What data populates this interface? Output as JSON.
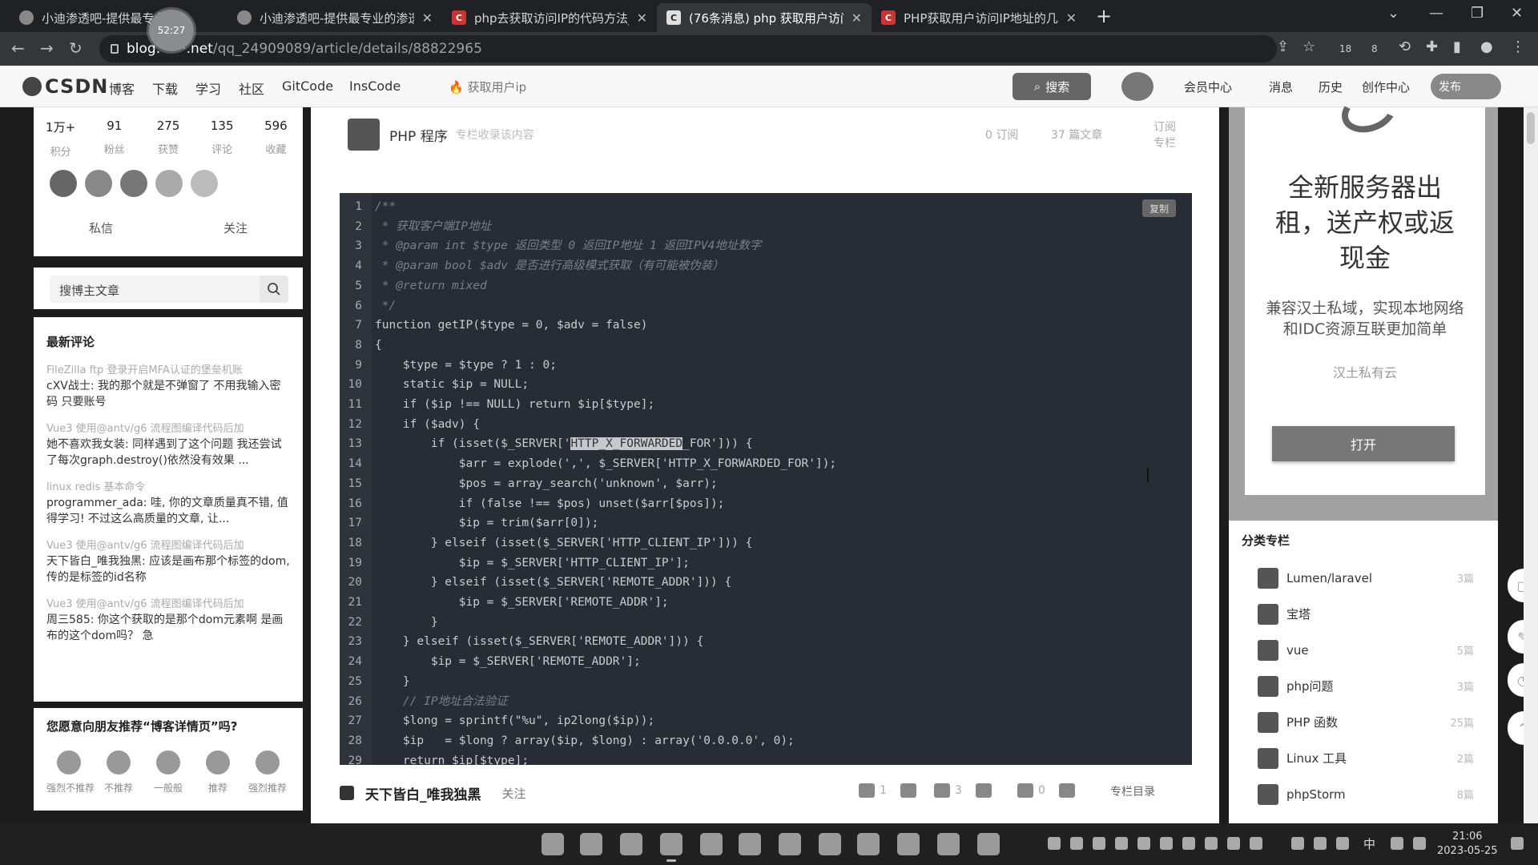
{
  "browser": {
    "timer": "52:27",
    "tabs": [
      {
        "title": "小迪渗透吧-提供最专业",
        "active": false
      },
      {
        "title": "小迪渗透吧-提供最专业的渗透测",
        "active": false
      },
      {
        "title": "php去获取访问IP的代码方法_百",
        "active": false
      },
      {
        "title": "(76条消息) php 获取用户访问",
        "active": true
      },
      {
        "title": "PHP获取用户访问IP地址的几种",
        "active": false
      }
    ],
    "url_host": "blog",
    "url_mid": "net",
    "url_path": "/qq_24909089/article/details/88822965",
    "ext_badges": [
      "18",
      "8"
    ]
  },
  "csdn_nav": {
    "logo": "CSDN",
    "links": [
      "博客",
      "下载",
      "学习",
      "社区",
      "GitCode",
      "InsCode"
    ],
    "search_hint": "获取用户ip",
    "search_button": "搜索",
    "right_links": [
      "会员中心",
      "消息",
      "历史",
      "创作中心"
    ],
    "publish": "发布"
  },
  "profile": {
    "stats": [
      {
        "value": "1万+",
        "label": "积分"
      },
      {
        "value": "91",
        "label": "粉丝"
      },
      {
        "value": "275",
        "label": "获赞"
      },
      {
        "value": "135",
        "label": "评论"
      },
      {
        "value": "596",
        "label": "收藏"
      }
    ],
    "actions": [
      "私信",
      "关注"
    ]
  },
  "blog_search": {
    "placeholder": "搜博主文章"
  },
  "latest_comments": {
    "title": "最新评论",
    "items": [
      {
        "source": "FileZilla ftp 登录开启MFA认证的堡垒机账",
        "text": "cXV战士: 我的那个就是不弹窗了 不用我输入密码 只要账号"
      },
      {
        "source": "Vue3 使用@antv/g6 流程图编译代码后加",
        "text": "她不喜欢我女装: 同样遇到了这个问题 我还尝试了每次graph.destroy()依然没有效果 ..."
      },
      {
        "source": "linux redis 基本命令",
        "text": "programmer_ada: 哇, 你的文章质量真不错, 值得学习! 不过这么高质量的文章, 让..."
      },
      {
        "source": "Vue3 使用@antv/g6 流程图编译代码后加",
        "text": "天下皆白_唯我独黑: 应该是画布那个标签的dom, 传的是标签的id名称"
      },
      {
        "source": "Vue3 使用@antv/g6 流程图编译代码后加",
        "text": "周三585: 你这个获取的是那个dom元素啊 是画布的这个dom吗？ 急"
      }
    ]
  },
  "recommend": {
    "title": "您愿意向朋友推荐“博客详情页”吗?",
    "options": [
      "强烈不推荐",
      "不推荐",
      "一般般",
      "推荐",
      "强烈推荐"
    ]
  },
  "column": {
    "name": "PHP 程序",
    "desc": "专栏收录该内容",
    "subscribers": "0 订阅",
    "articles": "37 篇文章",
    "subscribe": "订阅专栏"
  },
  "code": {
    "copy_label": "复制",
    "lines": [
      {
        "n": "1",
        "text": "/**",
        "comment": true
      },
      {
        "n": "2",
        "text": " * 获取客户端IP地址",
        "comment": true
      },
      {
        "n": "3",
        "text": " * @param int $type 返回类型 0 返回IP地址 1 返回IPV4地址数字",
        "comment": true
      },
      {
        "n": "4",
        "text": " * @param bool $adv 是否进行高级模式获取（有可能被伪装）",
        "comment": true
      },
      {
        "n": "5",
        "text": " * @return mixed",
        "comment": true
      },
      {
        "n": "6",
        "text": " */",
        "comment": true
      },
      {
        "n": "7",
        "text": "function getIP($type = 0, $adv = false)",
        "comment": false
      },
      {
        "n": "8",
        "text": "{",
        "comment": false
      },
      {
        "n": "9",
        "text": "    $type = $type ? 1 : 0;",
        "comment": false
      },
      {
        "n": "10",
        "text": "    static $ip = NULL;",
        "comment": false
      },
      {
        "n": "11",
        "text": "    if ($ip !== NULL) return $ip[$type];",
        "comment": false
      },
      {
        "n": "12",
        "text": "    if ($adv) {",
        "comment": false
      },
      {
        "n": "13",
        "pre": "        if (isset($_SERVER['",
        "hl": "HTTP_X_FORWARDED",
        "post": "_FOR'])) {",
        "comment": false
      },
      {
        "n": "14",
        "text": "            $arr = explode(',', $_SERVER['HTTP_X_FORWARDED_FOR']);",
        "comment": false
      },
      {
        "n": "15",
        "text": "            $pos = array_search('unknown', $arr);",
        "comment": false
      },
      {
        "n": "16",
        "text": "            if (false !== $pos) unset($arr[$pos]);",
        "comment": false
      },
      {
        "n": "17",
        "text": "            $ip = trim($arr[0]);",
        "comment": false
      },
      {
        "n": "18",
        "text": "        } elseif (isset($_SERVER['HTTP_CLIENT_IP'])) {",
        "comment": false
      },
      {
        "n": "19",
        "text": "            $ip = $_SERVER['HTTP_CLIENT_IP'];",
        "comment": false
      },
      {
        "n": "20",
        "text": "        } elseif (isset($_SERVER['REMOTE_ADDR'])) {",
        "comment": false
      },
      {
        "n": "21",
        "text": "            $ip = $_SERVER['REMOTE_ADDR'];",
        "comment": false
      },
      {
        "n": "22",
        "text": "        }",
        "comment": false
      },
      {
        "n": "23",
        "text": "    } elseif (isset($_SERVER['REMOTE_ADDR'])) {",
        "comment": false
      },
      {
        "n": "24",
        "text": "        $ip = $_SERVER['REMOTE_ADDR'];",
        "comment": false
      },
      {
        "n": "25",
        "text": "    }",
        "comment": false
      },
      {
        "n": "26",
        "text": "    // IP地址合法验证",
        "comment": true
      },
      {
        "n": "27",
        "text": "    $long = sprintf(\"%u\", ip2long($ip));",
        "comment": false
      },
      {
        "n": "28",
        "text": "    $ip   = $long ? array($ip, $long) : array('0.0.0.0', 0);",
        "comment": false
      },
      {
        "n": "29",
        "text": "    return $ip[$type];",
        "comment": false
      }
    ]
  },
  "article_footer": {
    "author": "天下皆白_唯我独黑",
    "follow": "关注",
    "likes": "1",
    "favorites": "3",
    "comments": "0",
    "toc": "专栏目录"
  },
  "ad": {
    "headline": "全新服务器出租，送产权或返现金",
    "sub": "兼容汉土私域，实现本地网络和IDC资源互联更加简单",
    "brand": "汉土私有云",
    "button": "打开"
  },
  "categories": {
    "title": "分类专栏",
    "items": [
      {
        "name": "Lumen/laravel",
        "count": "3篇"
      },
      {
        "name": "宝塔",
        "count": ""
      },
      {
        "name": "vue",
        "count": "5篇"
      },
      {
        "name": "php问题",
        "count": "3篇"
      },
      {
        "name": "PHP 函数",
        "count": "25篇"
      },
      {
        "name": "Linux 工具",
        "count": "2篇"
      },
      {
        "name": "phpStorm",
        "count": "8篇"
      }
    ]
  },
  "taskbar": {
    "ime": "中",
    "time": "21:06",
    "date": "2023-05-25"
  }
}
